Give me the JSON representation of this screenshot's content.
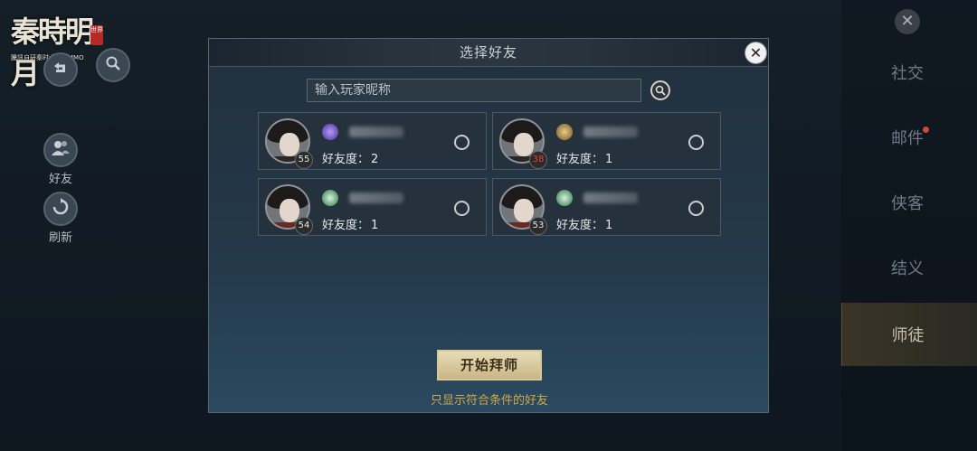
{
  "logo": {
    "title": "秦時明月",
    "seal": "世界",
    "subtitle": "騰訊自研秦时大世界MMO"
  },
  "left_nav": {
    "friends_label": "好友",
    "refresh_label": "刷新"
  },
  "right_tabs": [
    {
      "label": "社交",
      "active": false
    },
    {
      "label": "邮件",
      "active": false,
      "has_badge": true
    },
    {
      "label": "侠客",
      "active": false
    },
    {
      "label": "结义",
      "active": false
    },
    {
      "label": "师徒",
      "active": true
    }
  ],
  "dialog": {
    "title": "选择好友",
    "search_placeholder": "输入玩家昵称",
    "start_button": "开始拜师",
    "filter_text": "只显示符合条件的好友",
    "affinity_label": "好友度：",
    "friends": [
      {
        "level": "55",
        "affinity": "2",
        "school_icon": "purple-school-icon",
        "school_color": "#8a6bd6",
        "level_color": "normal"
      },
      {
        "level": "38",
        "affinity": "1",
        "school_icon": "gold-school-icon",
        "school_color": "#b99a5a",
        "level_color": "red"
      },
      {
        "level": "54",
        "affinity": "1",
        "school_icon": "green-school-icon",
        "school_color": "#6fae7e",
        "level_color": "normal"
      },
      {
        "level": "53",
        "affinity": "1",
        "school_icon": "green-school-icon",
        "school_color": "#6fae7e",
        "level_color": "normal"
      }
    ]
  },
  "colors": {
    "accent_gold": "#d1a74a",
    "button_gold": "#d7c79a",
    "dialog_border": "#58656f"
  }
}
